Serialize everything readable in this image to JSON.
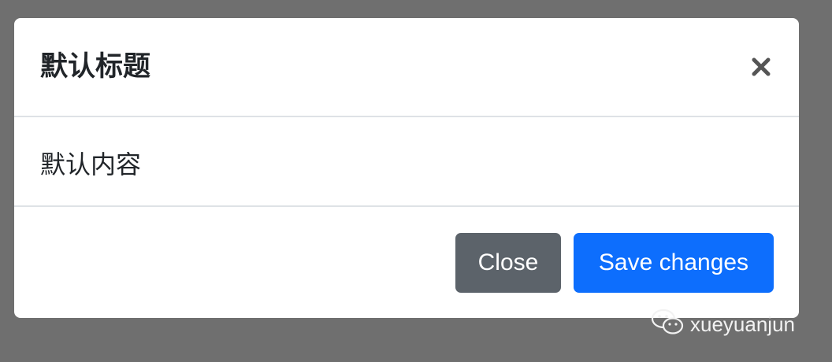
{
  "modal": {
    "title": "默认标题",
    "body_text": "默认内容",
    "close_icon": "close-icon"
  },
  "footer": {
    "close_label": "Close",
    "save_label": "Save changes"
  },
  "watermark": {
    "icon": "wechat-icon",
    "text": "xueyuanjun"
  },
  "colors": {
    "backdrop": "#6f6f6f",
    "close_button": "#5c636a",
    "save_button": "#0d6efd",
    "divider": "#dee2e6",
    "text": "#212529"
  }
}
